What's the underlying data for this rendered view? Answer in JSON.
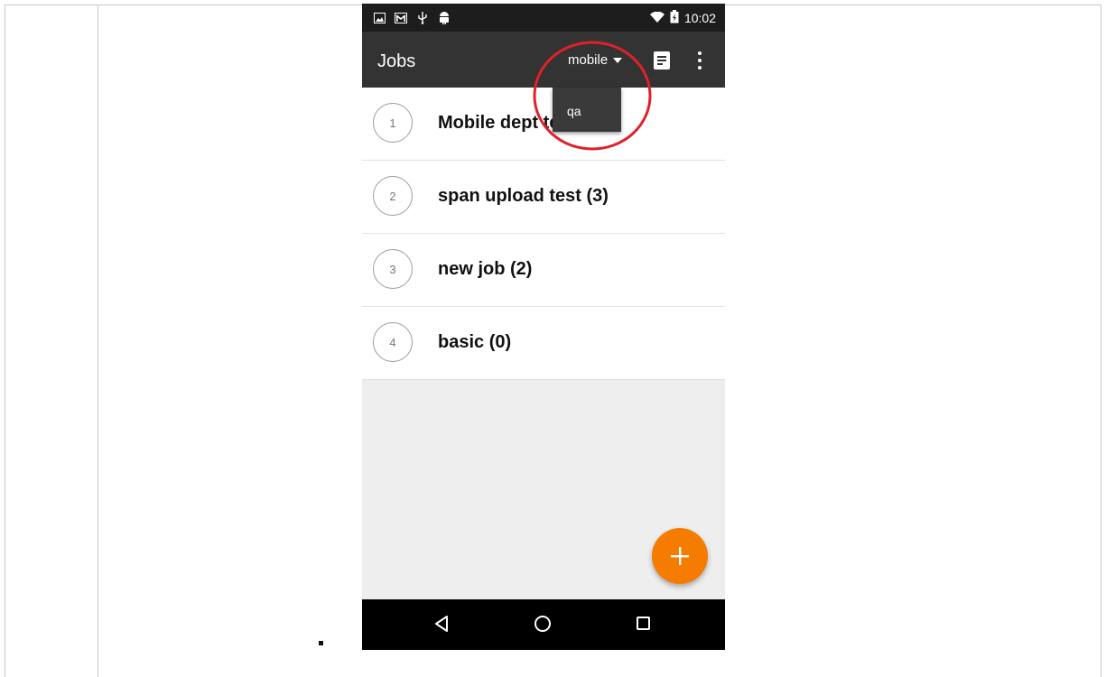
{
  "status_bar": {
    "time": "10:02"
  },
  "app_bar": {
    "title": "Jobs",
    "spinner_value": "mobile"
  },
  "dropdown": {
    "options": [
      "qa"
    ]
  },
  "jobs": [
    {
      "num": "1",
      "label": "Mobile dept test (4)"
    },
    {
      "num": "2",
      "label": "span upload test (3)"
    },
    {
      "num": "3",
      "label": "new job (2)"
    },
    {
      "num": "4",
      "label": "basic (0)"
    }
  ],
  "colors": {
    "app_bar": "#333333",
    "status_bar": "#1d1d1d",
    "fab": "#f57c00",
    "annotation_circle": "#e0202a"
  },
  "icons": [
    "image-icon",
    "gmail-icon",
    "usb-icon",
    "android-icon",
    "wifi-icon",
    "battery-icon",
    "document-icon",
    "more-vert-icon",
    "add-icon",
    "back-icon",
    "home-icon",
    "recents-icon"
  ]
}
